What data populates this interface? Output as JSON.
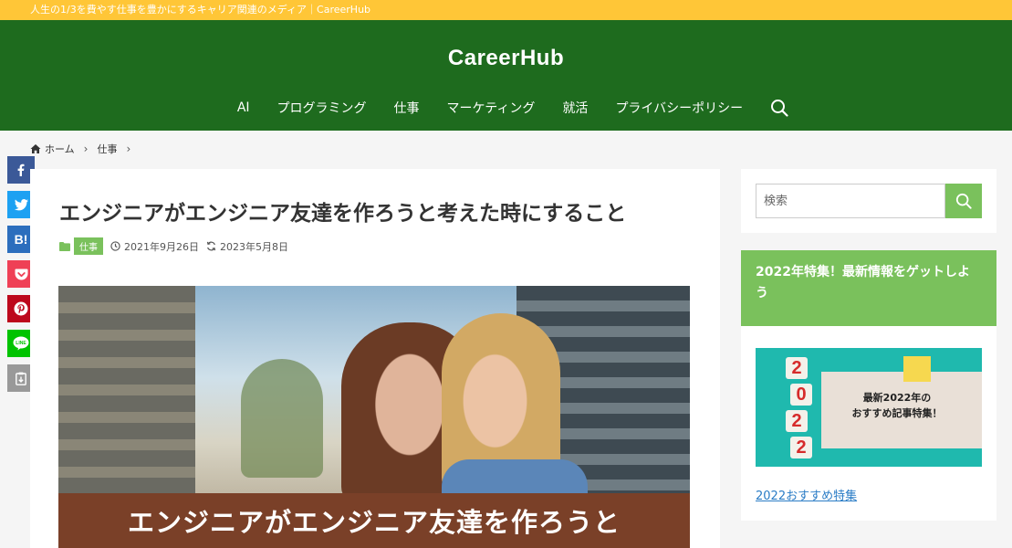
{
  "topbar": {
    "tagline": "人生の1/3を費やす仕事を豊かにするキャリア関連のメディア｜CareerHub"
  },
  "header": {
    "site_title": "CareerHub",
    "nav": [
      "AI",
      "プログラミング",
      "仕事",
      "マーケティング",
      "就活",
      "プライバシーポリシー"
    ]
  },
  "breadcrumb": {
    "home": "ホーム",
    "category": "仕事"
  },
  "share": {
    "hatena_label": "B!"
  },
  "article": {
    "title": "エンジニアがエンジニア友達を作ろうと考えた時にすること",
    "category": "仕事",
    "published": "2021年9月26日",
    "updated": "2023年5月8日",
    "eyecatch_text": "エンジニアがエンジニア友達を作ろうと"
  },
  "sidebar": {
    "search_placeholder": "検索",
    "widget_title": "2022年特集！最新情報をゲットしよう",
    "widget_image": {
      "digits": [
        "2",
        "0",
        "2",
        "2"
      ],
      "line1": "最新2022年の",
      "line2": "おすすめ記事特集！"
    },
    "widget_link": "2022おすすめ特集"
  },
  "colors": {
    "topbar": "#ffc637",
    "header": "#1e6b1e",
    "accent": "#7ac15c",
    "link": "#2a7cc6"
  }
}
